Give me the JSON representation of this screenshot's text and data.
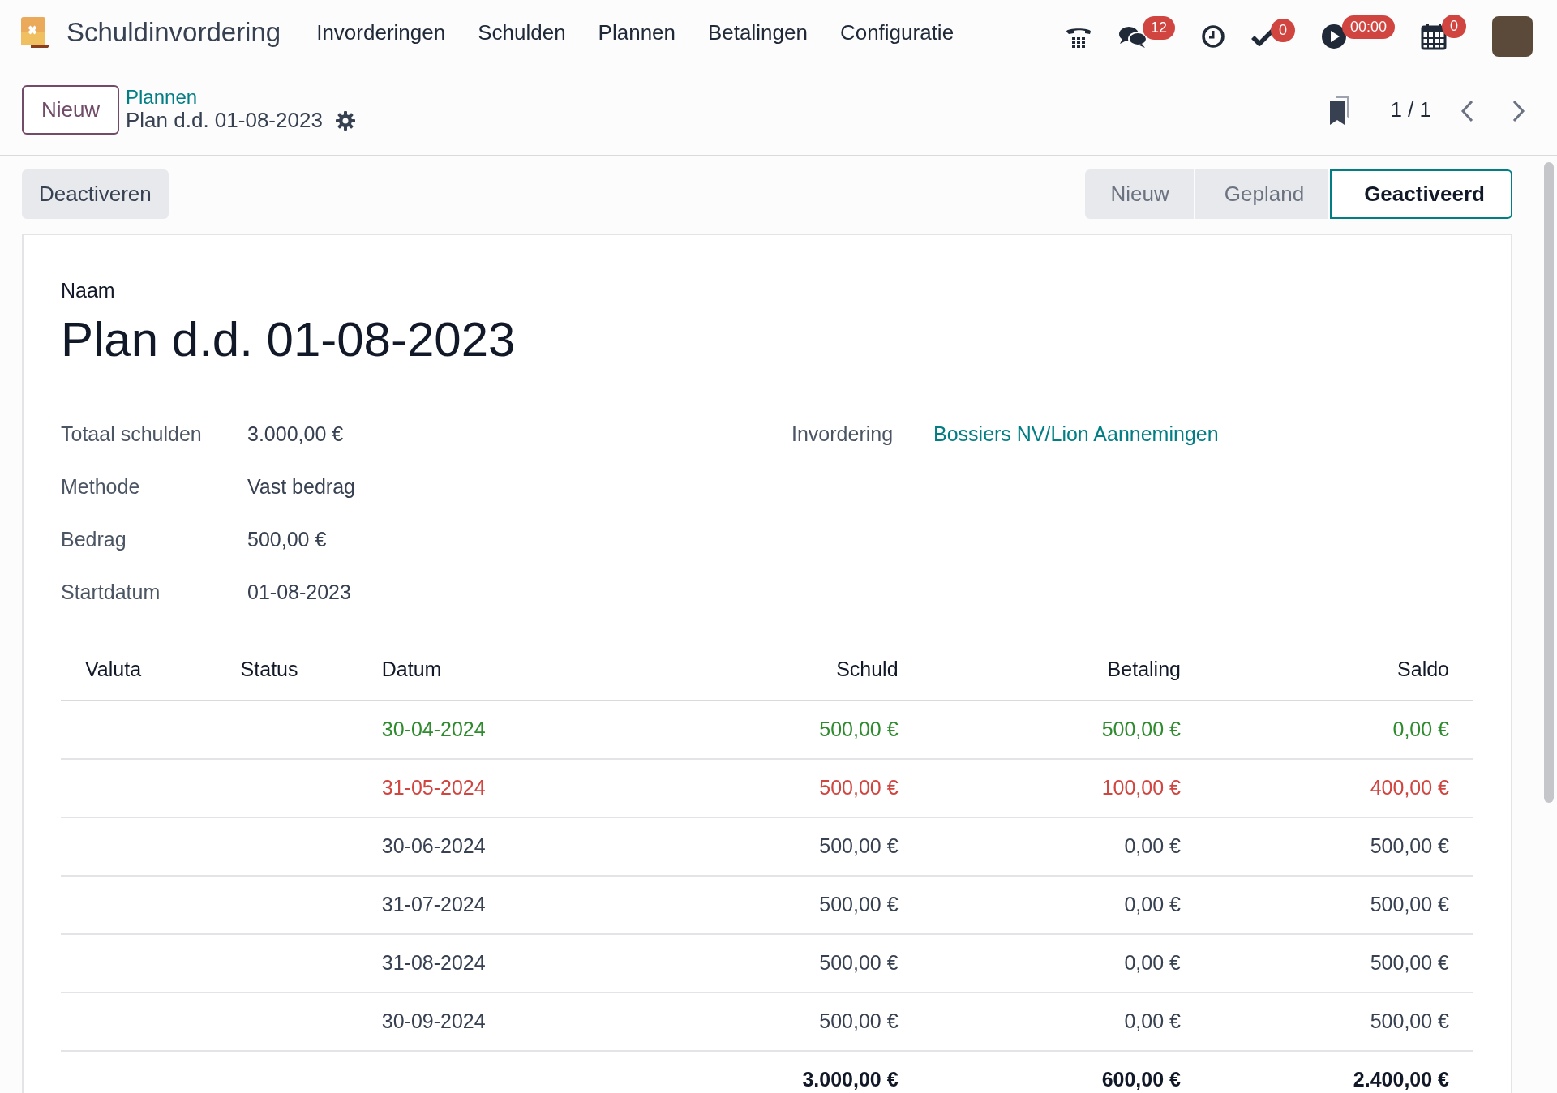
{
  "app": {
    "name": "Schuldinvordering"
  },
  "menu": [
    {
      "label": "Invorderingen"
    },
    {
      "label": "Schulden"
    },
    {
      "label": "Plannen"
    },
    {
      "label": "Betalingen"
    },
    {
      "label": "Configuratie"
    }
  ],
  "systray": [
    {
      "kind": "phone"
    },
    {
      "kind": "chat",
      "badge": "12"
    },
    {
      "kind": "clock"
    },
    {
      "kind": "check",
      "badge": "0"
    },
    {
      "kind": "play",
      "badge": "00:00"
    },
    {
      "kind": "calendar",
      "badge": "0"
    },
    {
      "kind": "avatar"
    }
  ],
  "control_panel": {
    "new_button": "Nieuw",
    "breadcrumb": "Plannen",
    "record_title": "Plan d.d. 01-08-2023",
    "pager": "1 / 1"
  },
  "status_bar": {
    "button": "Deactiveren",
    "stages": [
      {
        "label": "Nieuw",
        "selected": false
      },
      {
        "label": "Gepland",
        "selected": false
      },
      {
        "label": "Geactiveerd",
        "selected": true
      }
    ]
  },
  "form": {
    "name_label": "Naam",
    "name": "Plan d.d. 01-08-2023",
    "left_fields": [
      {
        "label": "Totaal schulden",
        "value": "3.000,00 €"
      },
      {
        "label": "Methode",
        "value": "Vast bedrag"
      },
      {
        "label": "Bedrag",
        "value": "500,00 €"
      },
      {
        "label": "Startdatum",
        "value": "01-08-2023"
      }
    ],
    "right_fields": [
      {
        "label": "Invordering",
        "value": "Bossiers NV/Lion Aannemingen"
      }
    ]
  },
  "table": {
    "columns": [
      "Valuta",
      "Status",
      "Datum",
      "Schuld",
      "Betaling",
      "Saldo"
    ],
    "rows": [
      {
        "date": "30-04-2024",
        "debt": "500,00 €",
        "payment": "500,00 €",
        "balance": "0,00 €",
        "color": "#2e8b2e"
      },
      {
        "date": "31-05-2024",
        "debt": "500,00 €",
        "payment": "100,00 €",
        "balance": "400,00 €",
        "color": "#d0453f"
      },
      {
        "date": "30-06-2024",
        "debt": "500,00 €",
        "payment": "0,00 €",
        "balance": "500,00 €",
        "color": "#374151"
      },
      {
        "date": "31-07-2024",
        "debt": "500,00 €",
        "payment": "0,00 €",
        "balance": "500,00 €",
        "color": "#374151"
      },
      {
        "date": "31-08-2024",
        "debt": "500,00 €",
        "payment": "0,00 €",
        "balance": "500,00 €",
        "color": "#374151"
      },
      {
        "date": "30-09-2024",
        "debt": "500,00 €",
        "payment": "0,00 €",
        "balance": "500,00 €",
        "color": "#374151"
      }
    ],
    "totals": {
      "debt": "3.000,00 €",
      "payment": "600,00 €",
      "balance": "2.400,00 €"
    }
  }
}
